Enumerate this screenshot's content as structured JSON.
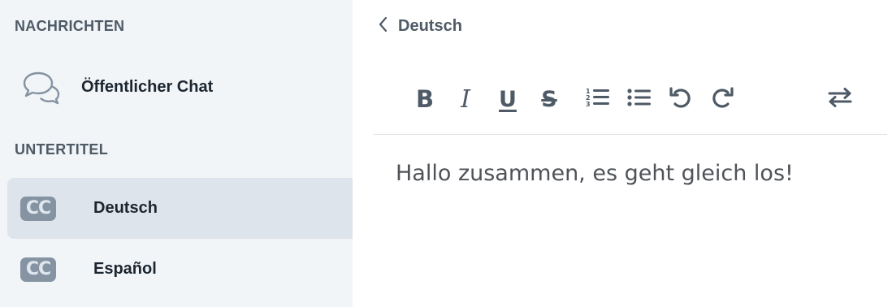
{
  "sidebar": {
    "messages_title": "NACHRICHTEN",
    "public_chat_label": "Öffentlicher Chat",
    "subtitles_title": "UNTERTITEL",
    "subtitles": [
      {
        "badge": "CC",
        "label": "Deutsch",
        "active": true
      },
      {
        "badge": "CC",
        "label": "Español",
        "active": false
      }
    ]
  },
  "header": {
    "back_label": "Deutsch"
  },
  "toolbar": {
    "bold": "B",
    "italic": "I",
    "underline": "U",
    "strike": "S"
  },
  "editor": {
    "text": "Hallo zusammen, es geht gleich los!"
  },
  "colors": {
    "sidebar_bg": "#f1f5f8",
    "active_item_bg": "#dee4eb",
    "icon_gray": "#4e5a66",
    "cc_badge": "#8593a2"
  },
  "icons": [
    "chat-bubbles-icon",
    "cc-icon",
    "chevron-left-icon",
    "ordered-list-icon",
    "bullet-list-icon",
    "undo-icon",
    "redo-icon",
    "swap-icon"
  ]
}
